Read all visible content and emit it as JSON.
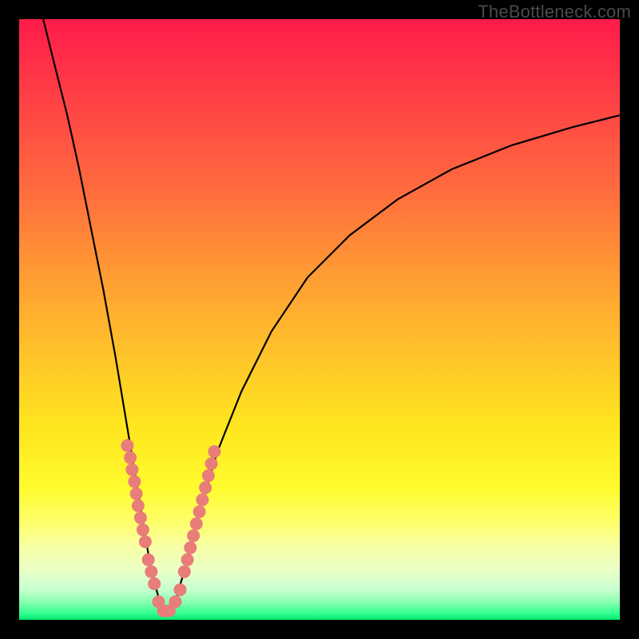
{
  "watermark": "TheBottleneck.com",
  "colors": {
    "frame": "#000000",
    "gradient_top": "#ff1b4a",
    "gradient_bottom": "#00e86f",
    "curve": "#000000",
    "dots": "#e87d7a"
  },
  "chart_data": {
    "type": "line",
    "title": "",
    "xlabel": "",
    "ylabel": "",
    "xlim": [
      0,
      100
    ],
    "ylim": [
      0,
      100
    ],
    "curve": {
      "description": "V-shaped bottleneck curve; minimum near x≈24, rising steeply left and gradually right",
      "points": [
        {
          "x": 4,
          "y": 100
        },
        {
          "x": 6,
          "y": 92
        },
        {
          "x": 8,
          "y": 84
        },
        {
          "x": 10,
          "y": 75
        },
        {
          "x": 12,
          "y": 65
        },
        {
          "x": 14,
          "y": 55
        },
        {
          "x": 16,
          "y": 44
        },
        {
          "x": 18,
          "y": 32
        },
        {
          "x": 20,
          "y": 20
        },
        {
          "x": 22,
          "y": 8
        },
        {
          "x": 24,
          "y": 1
        },
        {
          "x": 26,
          "y": 3
        },
        {
          "x": 28,
          "y": 10
        },
        {
          "x": 30,
          "y": 18
        },
        {
          "x": 33,
          "y": 28
        },
        {
          "x": 37,
          "y": 38
        },
        {
          "x": 42,
          "y": 48
        },
        {
          "x": 48,
          "y": 57
        },
        {
          "x": 55,
          "y": 64
        },
        {
          "x": 63,
          "y": 70
        },
        {
          "x": 72,
          "y": 75
        },
        {
          "x": 82,
          "y": 79
        },
        {
          "x": 92,
          "y": 82
        },
        {
          "x": 100,
          "y": 84
        }
      ]
    },
    "dots": {
      "description": "Salmon-colored data points clustered near the curve minimum on both branches",
      "points": [
        {
          "x": 18.0,
          "y": 29
        },
        {
          "x": 18.5,
          "y": 27
        },
        {
          "x": 18.8,
          "y": 25
        },
        {
          "x": 19.2,
          "y": 23
        },
        {
          "x": 19.5,
          "y": 21
        },
        {
          "x": 19.8,
          "y": 19
        },
        {
          "x": 20.2,
          "y": 17
        },
        {
          "x": 20.6,
          "y": 15
        },
        {
          "x": 21.0,
          "y": 13
        },
        {
          "x": 21.5,
          "y": 10
        },
        {
          "x": 22.0,
          "y": 8
        },
        {
          "x": 22.5,
          "y": 6
        },
        {
          "x": 23.2,
          "y": 3
        },
        {
          "x": 24.0,
          "y": 1.5
        },
        {
          "x": 25.0,
          "y": 1.5
        },
        {
          "x": 26.0,
          "y": 3
        },
        {
          "x": 26.8,
          "y": 5
        },
        {
          "x": 27.5,
          "y": 8
        },
        {
          "x": 28.0,
          "y": 10
        },
        {
          "x": 28.5,
          "y": 12
        },
        {
          "x": 29.0,
          "y": 14
        },
        {
          "x": 29.5,
          "y": 16
        },
        {
          "x": 30.0,
          "y": 18
        },
        {
          "x": 30.5,
          "y": 20
        },
        {
          "x": 31.0,
          "y": 22
        },
        {
          "x": 31.5,
          "y": 24
        },
        {
          "x": 32.0,
          "y": 26
        },
        {
          "x": 32.5,
          "y": 28
        }
      ],
      "radius": 8
    }
  }
}
